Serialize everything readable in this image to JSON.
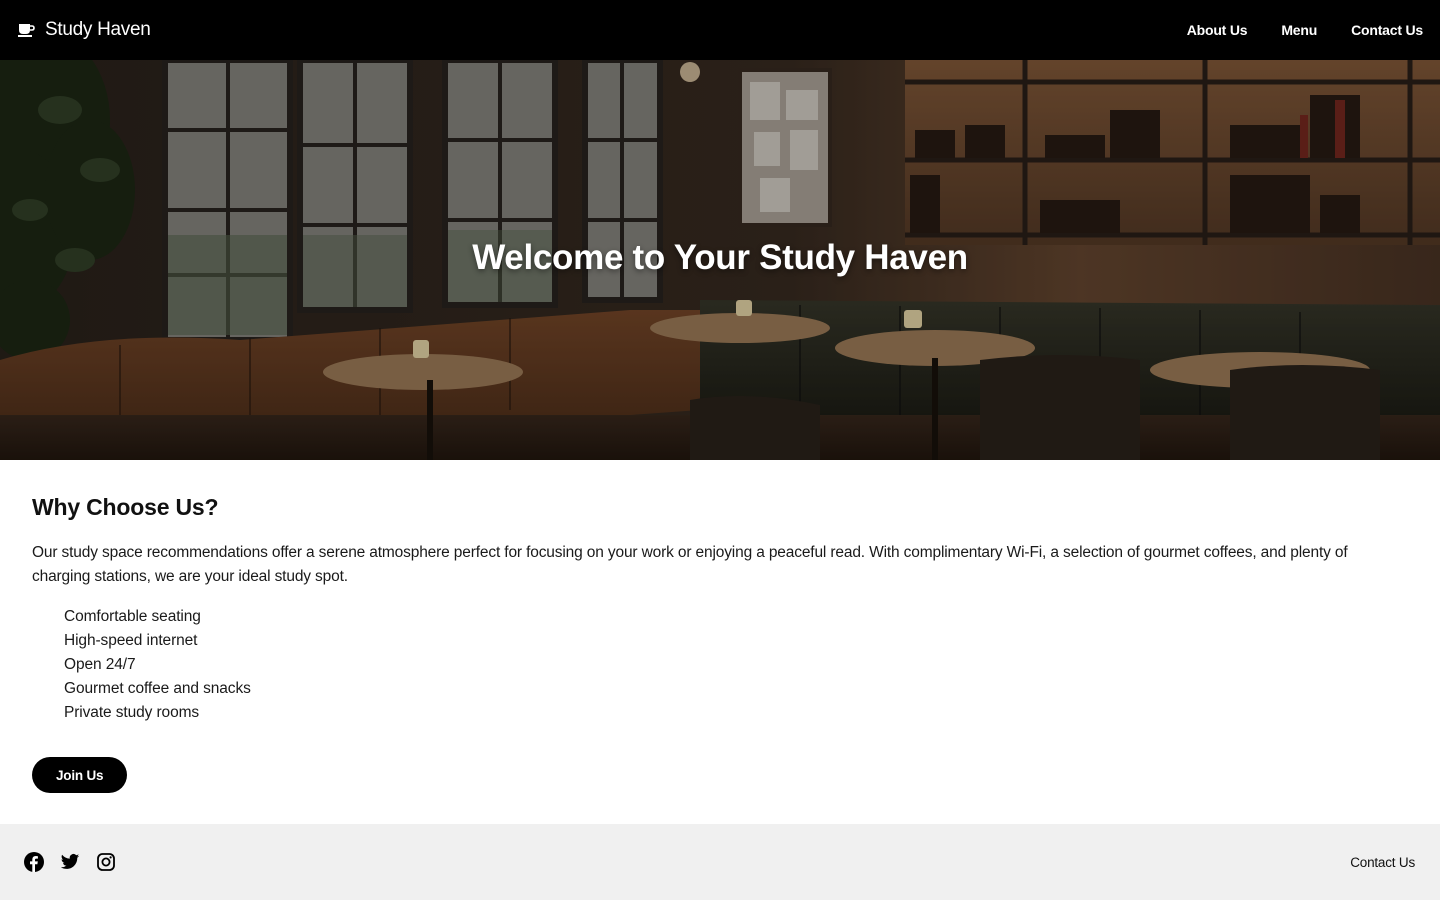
{
  "header": {
    "brand_icon": "coffee-cup-icon",
    "brand_name": "Study Haven",
    "nav": [
      {
        "label": "About Us"
      },
      {
        "label": "Menu"
      },
      {
        "label": "Contact Us"
      }
    ]
  },
  "hero": {
    "title": "Welcome to Your Study Haven",
    "image": "cafe-interior-photo"
  },
  "main": {
    "heading": "Why Choose Us?",
    "intro": "Our study space recommendations offer a serene atmosphere perfect for focusing on your work or enjoying a peaceful read. With complimentary Wi-Fi, a selection of gourmet coffees, and plenty of charging stations, we are your ideal study spot.",
    "features": [
      "Comfortable seating",
      "High-speed internet",
      "Open 24/7",
      "Gourmet coffee and snacks",
      "Private study rooms"
    ],
    "cta_label": "Join Us"
  },
  "footer": {
    "socials": [
      "facebook-icon",
      "twitter-icon",
      "instagram-icon"
    ],
    "contact_label": "Contact Us"
  },
  "colors": {
    "header_bg": "#000000",
    "footer_bg": "#f0f0f0",
    "button_bg": "#000000",
    "text": "#111111"
  }
}
